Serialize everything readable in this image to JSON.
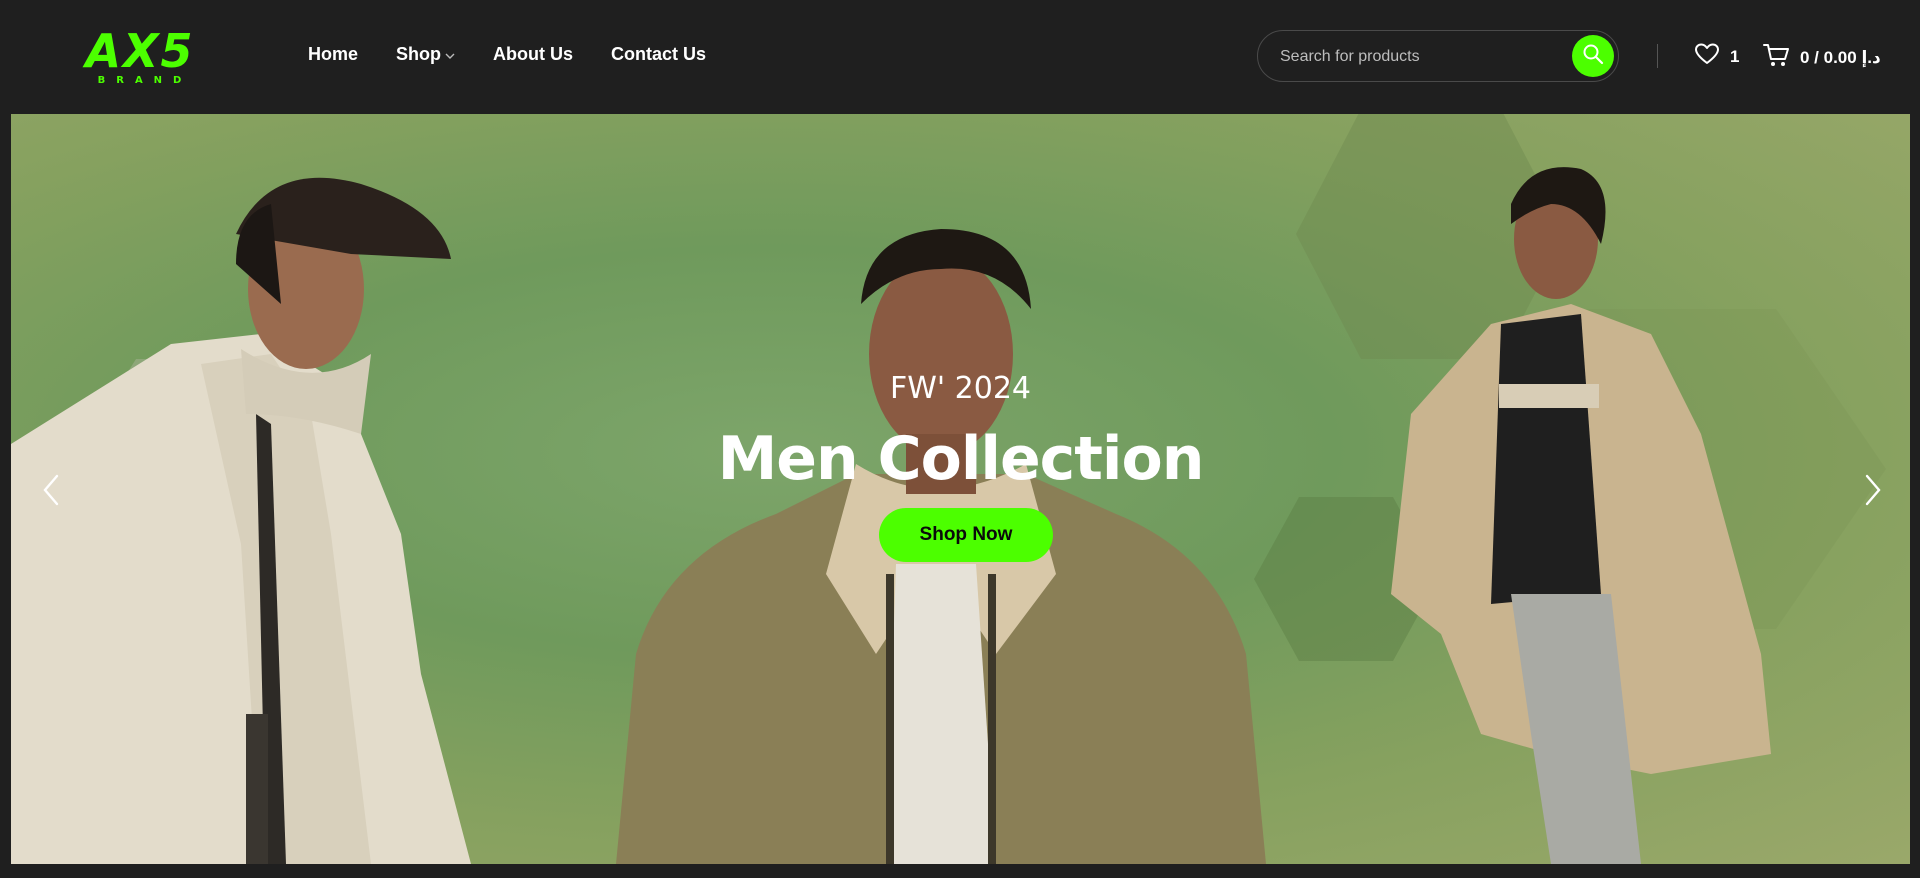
{
  "brand": {
    "name": "AX5",
    "tagline": "BRAND",
    "accent_color": "#4cff00"
  },
  "nav": {
    "items": [
      {
        "label": "Home"
      },
      {
        "label": "Shop",
        "has_dropdown": true
      },
      {
        "label": "About Us"
      },
      {
        "label": "Contact Us"
      }
    ]
  },
  "search": {
    "placeholder": "Search for products",
    "icon": "search-icon"
  },
  "header_actions": {
    "wishlist_count": "1",
    "cart_text": "0 / 0.00 د.إ"
  },
  "hero": {
    "subtitle": "FW' 2024",
    "title": "Men Collection",
    "cta_label": "Shop Now"
  }
}
